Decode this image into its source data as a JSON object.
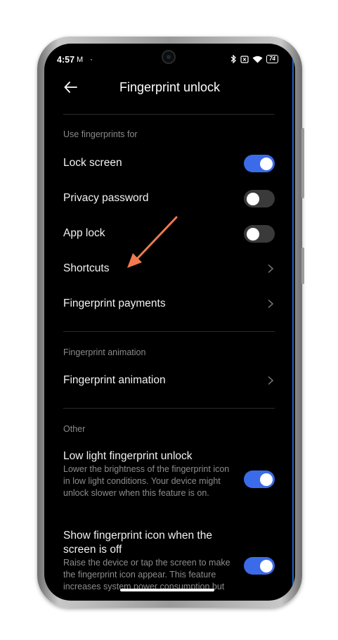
{
  "status_bar": {
    "time": "4:57",
    "mail_icon": "M",
    "dot": "·",
    "icons": [
      "bluetooth-icon",
      "sim-off-icon",
      "wifi-icon"
    ],
    "battery": "74"
  },
  "header": {
    "title": "Fingerprint unlock",
    "back_icon": "back-arrow-icon"
  },
  "sections": {
    "use_for": {
      "label": "Use fingerprints for",
      "lock_screen": "Lock screen",
      "privacy_password": "Privacy password",
      "app_lock": "App lock",
      "shortcuts": "Shortcuts",
      "fingerprint_payments": "Fingerprint payments"
    },
    "animation": {
      "label": "Fingerprint animation",
      "fingerprint_animation": "Fingerprint animation"
    },
    "other": {
      "label": "Other",
      "low_light_title": "Low light fingerprint unlock",
      "low_light_desc": "Lower the brightness of the fingerprint icon in low light conditions. Your device might unlock slower when this feature is on.",
      "show_icon_title": "Show fingerprint icon when the screen is off",
      "show_icon_desc": "Raise the device or tap the screen to make the fingerprint icon appear. This feature increases system power consumption but"
    }
  },
  "toggles": {
    "lock_screen": true,
    "privacy_password": false,
    "app_lock": false,
    "low_light": true,
    "show_icon": true
  },
  "colors": {
    "toggle_on": "#3b6be8",
    "toggle_off": "#3a3a3a",
    "annotation_arrow": "#f07a4e"
  }
}
